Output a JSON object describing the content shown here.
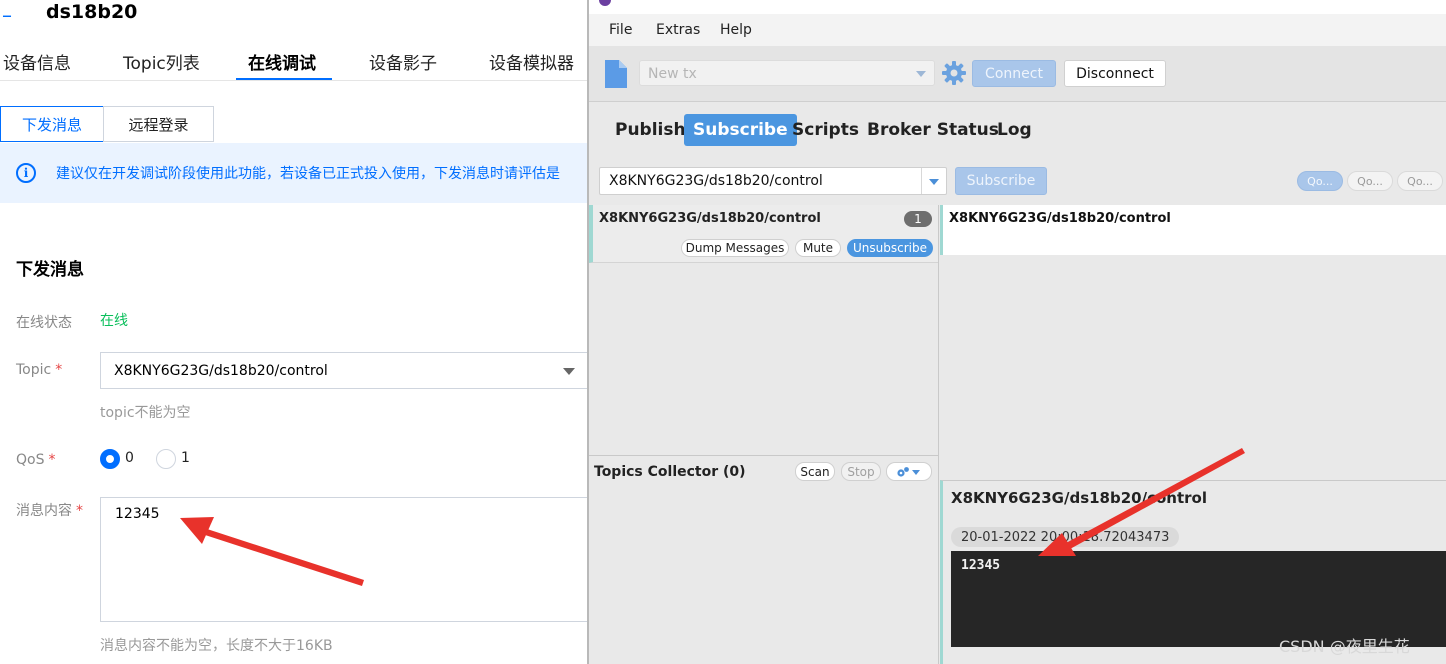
{
  "console": {
    "back_glyph": "–",
    "device_title": "ds18b20",
    "tabs": [
      "设备信息",
      "Topic列表",
      "在线调试",
      "设备影子",
      "设备模拟器"
    ],
    "sub_tabs": [
      "下发消息",
      "远程登录"
    ],
    "notice": "建议仅在开发调试阶段使用此功能，若设备已正式投入使用，下发消息时请评估是",
    "info_glyph": "i",
    "section_title": "下发消息",
    "form": {
      "status_label": "在线状态",
      "status_value": "在线",
      "topic_label": "Topic",
      "topic_value": "X8KNY6G23G/ds18b20/control",
      "topic_hint": "topic不能为空",
      "qos_label": "QoS",
      "qos_options": [
        "0",
        "1"
      ],
      "qos_selected": "0",
      "content_label": "消息内容",
      "content_value": "12345",
      "content_hint": "消息内容不能为空，长度不大于16KB",
      "required_mark": "*"
    }
  },
  "mqtt": {
    "menu": [
      "File",
      "Extras",
      "Help"
    ],
    "profile": "New tx",
    "connect_label": "Connect",
    "disconnect_label": "Disconnect",
    "tabs": [
      "Publish",
      "Subscribe",
      "Scripts",
      "Broker Status",
      "Log"
    ],
    "active_tab": "Subscribe",
    "subscribe_topic": "X8KNY6G23G/ds18b20/control",
    "subscribe_label": "Subscribe",
    "qos_buttons": [
      "Qo...",
      "Qo...",
      "Qo..."
    ],
    "subscription": {
      "topic": "X8KNY6G23G/ds18b20/control",
      "count": "1",
      "dump_label": "Dump Messages",
      "mute_label": "Mute",
      "unsubscribe_label": "Unsubscribe"
    },
    "topics_collector": {
      "title": "Topics Collector (0)",
      "scan_label": "Scan",
      "stop_label": "Stop"
    },
    "message_list_topic": "X8KNY6G23G/ds18b20/control",
    "message_detail": {
      "topic": "X8KNY6G23G/ds18b20/control",
      "timestamp": "20-01-2022  20:00:18.72043473",
      "payload": "12345"
    }
  },
  "watermark": "CSDN @夜里生花",
  "colors": {
    "console_accent": "#006eff",
    "online_green": "#0abf5b",
    "mqtt_tab_active": "#4b96e0",
    "arrow_red": "#e8322b"
  }
}
